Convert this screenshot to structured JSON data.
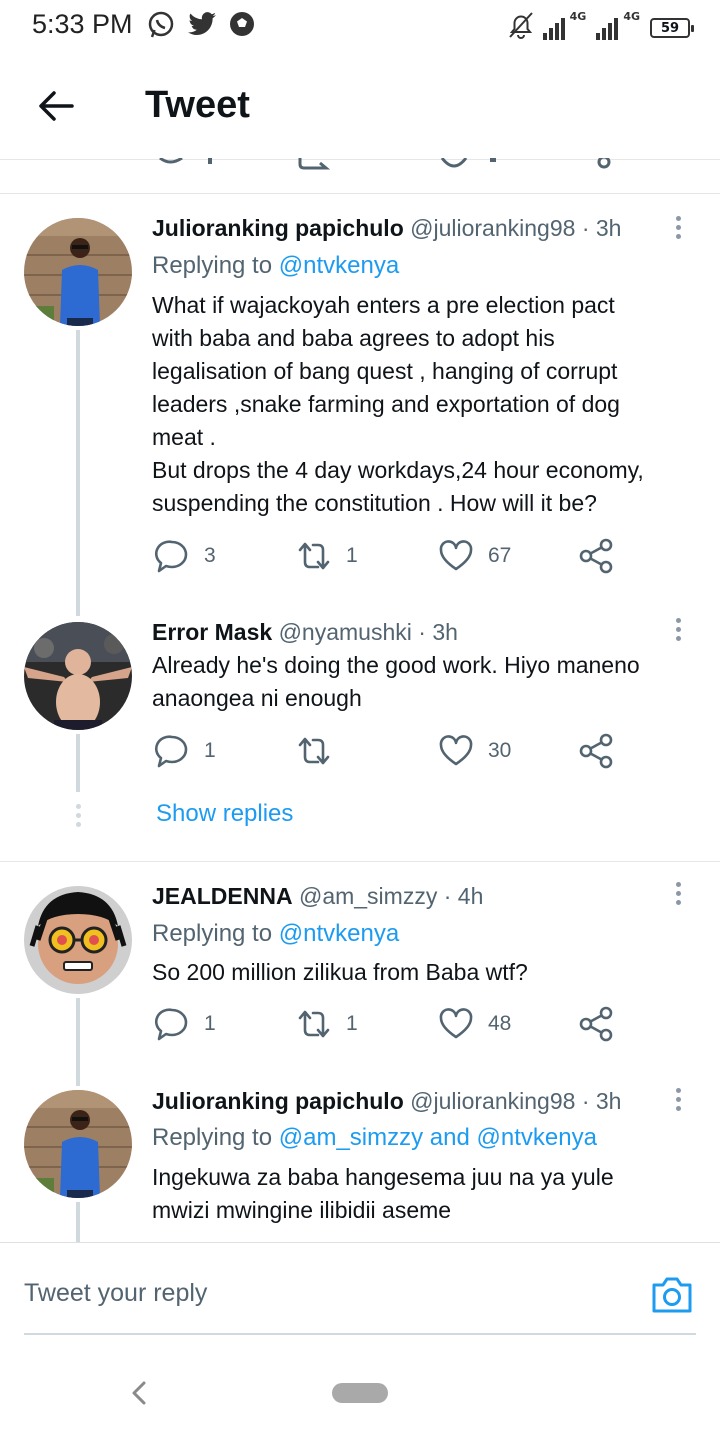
{
  "status_bar": {
    "time": "5:33 PM",
    "icons": [
      "whatsapp-icon",
      "twitter-icon",
      "soccer-ball-icon",
      "bell-muted-icon",
      "signal-icon",
      "signal-icon"
    ],
    "network_1": "4G",
    "network_2": "4G",
    "battery": "59"
  },
  "header": {
    "title": "Tweet",
    "back_icon": "arrow-left-icon"
  },
  "tweets": [
    {
      "name": "Julioranking papichulo",
      "handle": "@julioranking98",
      "dot": "·",
      "age": "3h",
      "replying_prefix": "Replying to",
      "replying_to": "@ntvkenya",
      "lines": [
        "What if wajackoyah enters a pre election pact",
        "with baba and baba agrees to adopt his",
        "legalisation of bang quest , hanging of corrupt",
        "leaders ,snake farming and exportation of dog",
        "meat .",
        "But drops the 4 day workdays,24 hour economy,",
        "suspending the constitution . How will it be?"
      ],
      "replies": "3",
      "retweets": "1",
      "likes": "67"
    },
    {
      "name": "Error Mask",
      "handle": "@nyamushki",
      "dot": "·",
      "age": "3h",
      "lines": [
        "Already he's doing the good work. Hiyo maneno",
        "anaongea ni enough"
      ],
      "replies": "1",
      "retweets": "",
      "likes": "30"
    },
    {
      "name": "JEALDENNA",
      "handle": "@am_simzzy",
      "dot": "·",
      "age": "4h",
      "replying_prefix": "Replying to",
      "replying_to": "@ntvkenya",
      "lines": [
        "So 200 million zilikua from Baba wtf?"
      ],
      "replies": "1",
      "retweets": "1",
      "likes": "48"
    },
    {
      "name": "Julioranking papichulo",
      "handle": "@julioranking98",
      "dot": "·",
      "age": "3h",
      "replying_prefix": "Replying to",
      "replying_to": "@am_simzzy",
      "replying_and": "and",
      "replying_to_2": "@ntvkenya",
      "lines": [
        "Ingekuwa za baba hangesema juu na ya yule",
        "mwizi mwingine ilibidii aseme"
      ]
    }
  ],
  "show_replies": "Show replies",
  "reply_bar": {
    "placeholder": "Tweet your reply",
    "camera_icon": "camera-icon"
  },
  "nav_bar": {
    "back_icon": "chevron-left-icon",
    "home_icon": "home-pill-icon"
  },
  "colors": {
    "accent": "#1d9bf0",
    "text": "#0f1419",
    "secondary": "#536471",
    "thread_line": "#cfd9de"
  }
}
